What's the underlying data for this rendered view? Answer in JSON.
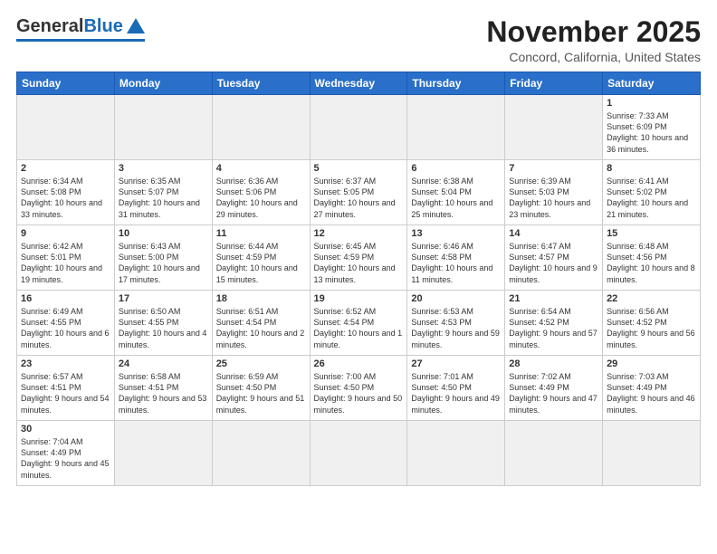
{
  "header": {
    "logo_general": "General",
    "logo_blue": "Blue",
    "month_year": "November 2025",
    "location": "Concord, California, United States"
  },
  "days_of_week": [
    "Sunday",
    "Monday",
    "Tuesday",
    "Wednesday",
    "Thursday",
    "Friday",
    "Saturday"
  ],
  "weeks": [
    [
      {
        "day": "",
        "empty": true
      },
      {
        "day": "",
        "empty": true
      },
      {
        "day": "",
        "empty": true
      },
      {
        "day": "",
        "empty": true
      },
      {
        "day": "",
        "empty": true
      },
      {
        "day": "",
        "empty": true
      },
      {
        "day": "1",
        "info": "Sunrise: 7:33 AM\nSunset: 6:09 PM\nDaylight: 10 hours and 36 minutes."
      }
    ],
    [
      {
        "day": "2",
        "info": "Sunrise: 6:34 AM\nSunset: 5:08 PM\nDaylight: 10 hours and 33 minutes."
      },
      {
        "day": "3",
        "info": "Sunrise: 6:35 AM\nSunset: 5:07 PM\nDaylight: 10 hours and 31 minutes."
      },
      {
        "day": "4",
        "info": "Sunrise: 6:36 AM\nSunset: 5:06 PM\nDaylight: 10 hours and 29 minutes."
      },
      {
        "day": "5",
        "info": "Sunrise: 6:37 AM\nSunset: 5:05 PM\nDaylight: 10 hours and 27 minutes."
      },
      {
        "day": "6",
        "info": "Sunrise: 6:38 AM\nSunset: 5:04 PM\nDaylight: 10 hours and 25 minutes."
      },
      {
        "day": "7",
        "info": "Sunrise: 6:39 AM\nSunset: 5:03 PM\nDaylight: 10 hours and 23 minutes."
      },
      {
        "day": "8",
        "info": "Sunrise: 6:41 AM\nSunset: 5:02 PM\nDaylight: 10 hours and 21 minutes."
      }
    ],
    [
      {
        "day": "9",
        "info": "Sunrise: 6:42 AM\nSunset: 5:01 PM\nDaylight: 10 hours and 19 minutes."
      },
      {
        "day": "10",
        "info": "Sunrise: 6:43 AM\nSunset: 5:00 PM\nDaylight: 10 hours and 17 minutes."
      },
      {
        "day": "11",
        "info": "Sunrise: 6:44 AM\nSunset: 4:59 PM\nDaylight: 10 hours and 15 minutes."
      },
      {
        "day": "12",
        "info": "Sunrise: 6:45 AM\nSunset: 4:59 PM\nDaylight: 10 hours and 13 minutes."
      },
      {
        "day": "13",
        "info": "Sunrise: 6:46 AM\nSunset: 4:58 PM\nDaylight: 10 hours and 11 minutes."
      },
      {
        "day": "14",
        "info": "Sunrise: 6:47 AM\nSunset: 4:57 PM\nDaylight: 10 hours and 9 minutes."
      },
      {
        "day": "15",
        "info": "Sunrise: 6:48 AM\nSunset: 4:56 PM\nDaylight: 10 hours and 8 minutes."
      }
    ],
    [
      {
        "day": "16",
        "info": "Sunrise: 6:49 AM\nSunset: 4:55 PM\nDaylight: 10 hours and 6 minutes."
      },
      {
        "day": "17",
        "info": "Sunrise: 6:50 AM\nSunset: 4:55 PM\nDaylight: 10 hours and 4 minutes."
      },
      {
        "day": "18",
        "info": "Sunrise: 6:51 AM\nSunset: 4:54 PM\nDaylight: 10 hours and 2 minutes."
      },
      {
        "day": "19",
        "info": "Sunrise: 6:52 AM\nSunset: 4:54 PM\nDaylight: 10 hours and 1 minute."
      },
      {
        "day": "20",
        "info": "Sunrise: 6:53 AM\nSunset: 4:53 PM\nDaylight: 9 hours and 59 minutes."
      },
      {
        "day": "21",
        "info": "Sunrise: 6:54 AM\nSunset: 4:52 PM\nDaylight: 9 hours and 57 minutes."
      },
      {
        "day": "22",
        "info": "Sunrise: 6:56 AM\nSunset: 4:52 PM\nDaylight: 9 hours and 56 minutes."
      }
    ],
    [
      {
        "day": "23",
        "info": "Sunrise: 6:57 AM\nSunset: 4:51 PM\nDaylight: 9 hours and 54 minutes."
      },
      {
        "day": "24",
        "info": "Sunrise: 6:58 AM\nSunset: 4:51 PM\nDaylight: 9 hours and 53 minutes."
      },
      {
        "day": "25",
        "info": "Sunrise: 6:59 AM\nSunset: 4:50 PM\nDaylight: 9 hours and 51 minutes."
      },
      {
        "day": "26",
        "info": "Sunrise: 7:00 AM\nSunset: 4:50 PM\nDaylight: 9 hours and 50 minutes."
      },
      {
        "day": "27",
        "info": "Sunrise: 7:01 AM\nSunset: 4:50 PM\nDaylight: 9 hours and 49 minutes."
      },
      {
        "day": "28",
        "info": "Sunrise: 7:02 AM\nSunset: 4:49 PM\nDaylight: 9 hours and 47 minutes."
      },
      {
        "day": "29",
        "info": "Sunrise: 7:03 AM\nSunset: 4:49 PM\nDaylight: 9 hours and 46 minutes."
      }
    ],
    [
      {
        "day": "30",
        "info": "Sunrise: 7:04 AM\nSunset: 4:49 PM\nDaylight: 9 hours and 45 minutes."
      },
      {
        "day": "",
        "empty": true
      },
      {
        "day": "",
        "empty": true
      },
      {
        "day": "",
        "empty": true
      },
      {
        "day": "",
        "empty": true
      },
      {
        "day": "",
        "empty": true
      },
      {
        "day": "",
        "empty": true
      }
    ]
  ]
}
